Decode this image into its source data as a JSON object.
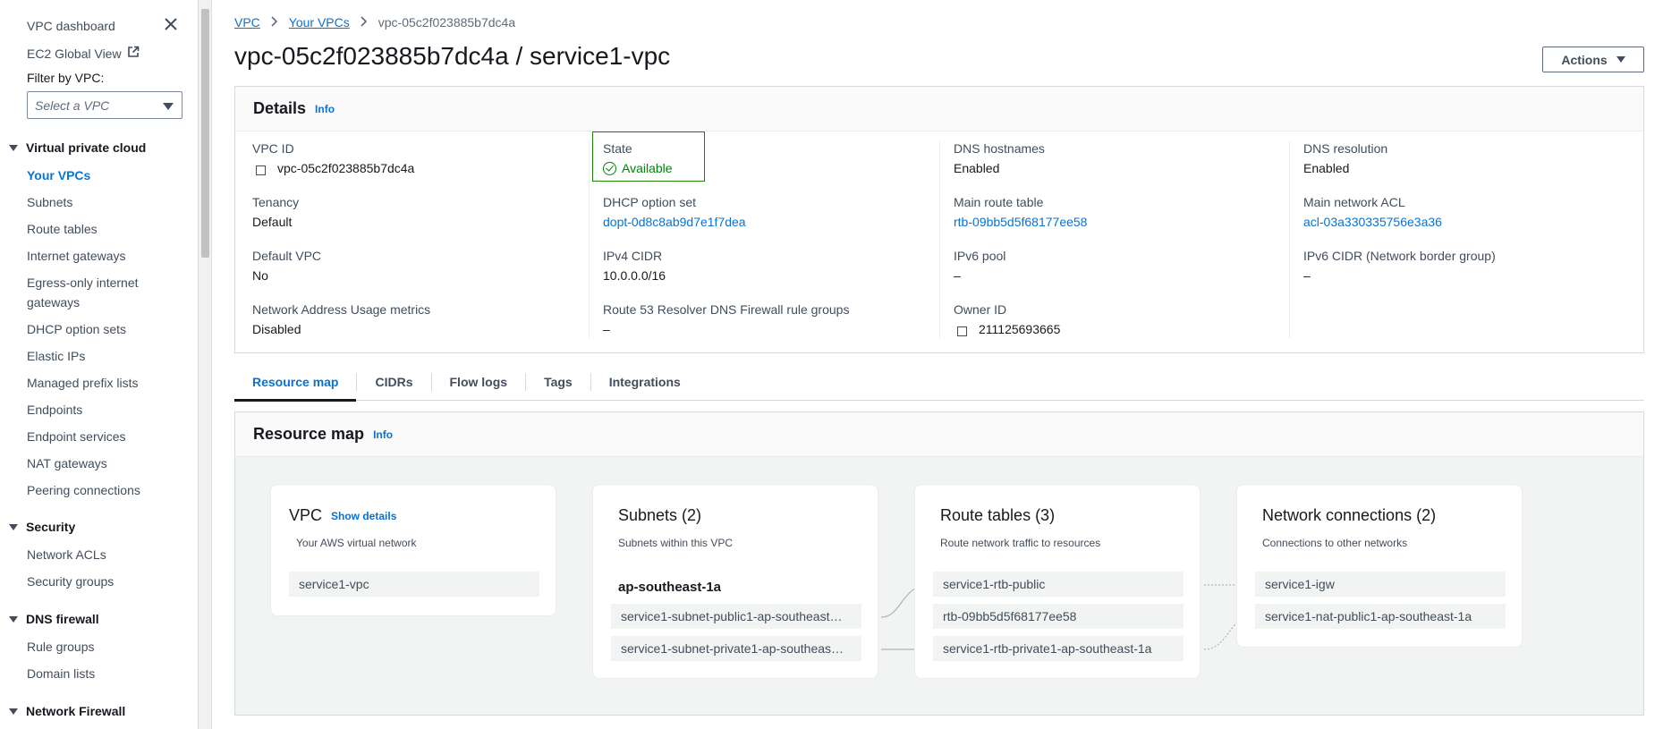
{
  "sidebar": {
    "top_links": [
      "VPC dashboard",
      "EC2 Global View"
    ],
    "filter_label": "Filter by VPC:",
    "filter_placeholder": "Select a VPC",
    "sections": [
      {
        "title": "Virtual private cloud",
        "items": [
          "Your VPCs",
          "Subnets",
          "Route tables",
          "Internet gateways",
          "Egress-only internet",
          "gateways",
          "DHCP option sets",
          "Elastic IPs",
          "Managed prefix lists",
          "Endpoints",
          "Endpoint services",
          "NAT gateways",
          "Peering connections"
        ]
      },
      {
        "title": "Security",
        "items": [
          "Network ACLs",
          "Security groups"
        ]
      },
      {
        "title": "DNS firewall",
        "items": [
          "Rule groups",
          "Domain lists"
        ]
      },
      {
        "title": "Network Firewall",
        "items": []
      }
    ],
    "active_item": "Your VPCs"
  },
  "breadcrumb": {
    "items": [
      "VPC",
      "Your VPCs"
    ],
    "current": "vpc-05c2f023885b7dc4a"
  },
  "page_title": "vpc-05c2f023885b7dc4a / service1-vpc",
  "actions_label": "Actions",
  "details": {
    "title": "Details",
    "info_label": "Info",
    "vpc_id_label": "VPC ID",
    "vpc_id": "vpc-05c2f023885b7dc4a",
    "state_label": "State",
    "state": "Available",
    "dns_hostnames_label": "DNS hostnames",
    "dns_hostnames": "Enabled",
    "dns_resolution_label": "DNS resolution",
    "dns_resolution": "Enabled",
    "tenancy_label": "Tenancy",
    "tenancy": "Default",
    "dhcp_label": "DHCP option set",
    "dhcp": "dopt-0d8c8ab9d7e1f7dea",
    "main_rt_label": "Main route table",
    "main_rt": "rtb-09bb5d5f68177ee58",
    "main_acl_label": "Main network ACL",
    "main_acl": "acl-03a330335756e3a36",
    "default_vpc_label": "Default VPC",
    "default_vpc": "No",
    "ipv4_label": "IPv4 CIDR",
    "ipv4": "10.0.0.0/16",
    "ipv6_pool_label": "IPv6 pool",
    "ipv6_pool": "–",
    "ipv6_cidr_label": "IPv6 CIDR (Network border group)",
    "ipv6_cidr": "–",
    "nau_label": "Network Address Usage metrics",
    "nau": "Disabled",
    "r53_label": "Route 53 Resolver DNS Firewall rule groups",
    "r53": "–",
    "owner_label": "Owner ID",
    "owner": "211125693665"
  },
  "tabs": [
    "Resource map",
    "CIDRs",
    "Flow logs",
    "Tags",
    "Integrations"
  ],
  "resource_map": {
    "title": "Resource map",
    "info_label": "Info",
    "vpc_card": {
      "title": "VPC",
      "show_details": "Show details",
      "subtitle": "Your AWS virtual network",
      "items": [
        "service1-vpc"
      ]
    },
    "subnets_card": {
      "title": "Subnets (2)",
      "subtitle": "Subnets within this VPC",
      "az": "ap-southeast-1a",
      "items": [
        "service1-subnet-public1-ap-southeast…",
        "service1-subnet-private1-ap-southeas…"
      ]
    },
    "rt_card": {
      "title": "Route tables (3)",
      "subtitle": "Route network traffic to resources",
      "items": [
        "service1-rtb-public",
        "rtb-09bb5d5f68177ee58",
        "service1-rtb-private1-ap-southeast-1a"
      ]
    },
    "net_card": {
      "title": "Network connections (2)",
      "subtitle": "Connections to other networks",
      "items": [
        "service1-igw",
        "service1-nat-public1-ap-southeast-1a"
      ]
    }
  }
}
